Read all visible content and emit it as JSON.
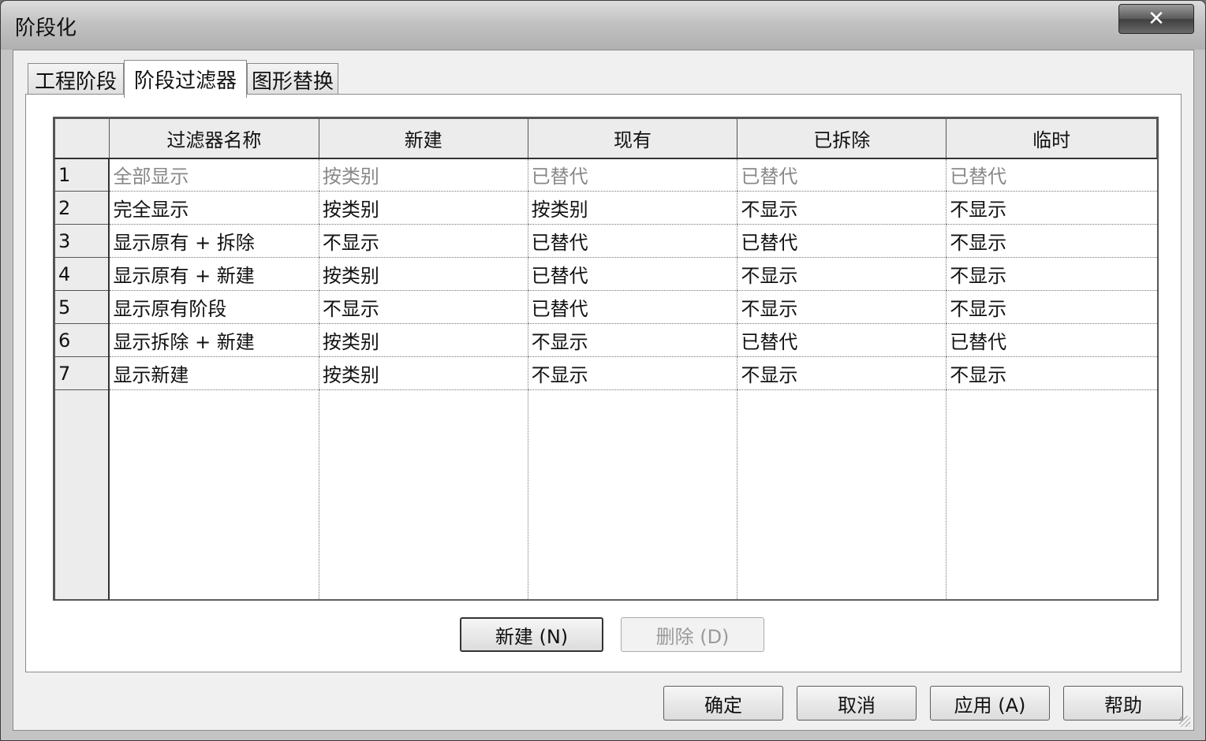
{
  "window": {
    "title": "阶段化",
    "close_label": "✕"
  },
  "tabs": [
    {
      "label": "工程阶段"
    },
    {
      "label": "阶段过滤器"
    },
    {
      "label": "图形替换"
    }
  ],
  "table": {
    "columns": [
      "过滤器名称",
      "新建",
      "现有",
      "已拆除",
      "临时"
    ],
    "rows": [
      {
        "num": "1",
        "cells": [
          "全部显示",
          "按类别",
          "已替代",
          "已替代",
          "已替代"
        ]
      },
      {
        "num": "2",
        "cells": [
          "完全显示",
          "按类别",
          "按类别",
          "不显示",
          "不显示"
        ]
      },
      {
        "num": "3",
        "cells": [
          "显示原有 + 拆除",
          "不显示",
          "已替代",
          "已替代",
          "不显示"
        ]
      },
      {
        "num": "4",
        "cells": [
          "显示原有 + 新建",
          "按类别",
          "已替代",
          "不显示",
          "不显示"
        ]
      },
      {
        "num": "5",
        "cells": [
          "显示原有阶段",
          "不显示",
          "已替代",
          "不显示",
          "不显示"
        ]
      },
      {
        "num": "6",
        "cells": [
          "显示拆除 + 新建",
          "按类别",
          "不显示",
          "已替代",
          "已替代"
        ]
      },
      {
        "num": "7",
        "cells": [
          "显示新建",
          "按类别",
          "不显示",
          "不显示",
          "不显示"
        ]
      }
    ]
  },
  "panel_buttons": {
    "new_label": "新建 (N)",
    "delete_label": "删除 (D)"
  },
  "footer_buttons": {
    "ok_label": "确定",
    "cancel_label": "取消",
    "apply_label": "应用 (A)",
    "help_label": "帮助"
  }
}
